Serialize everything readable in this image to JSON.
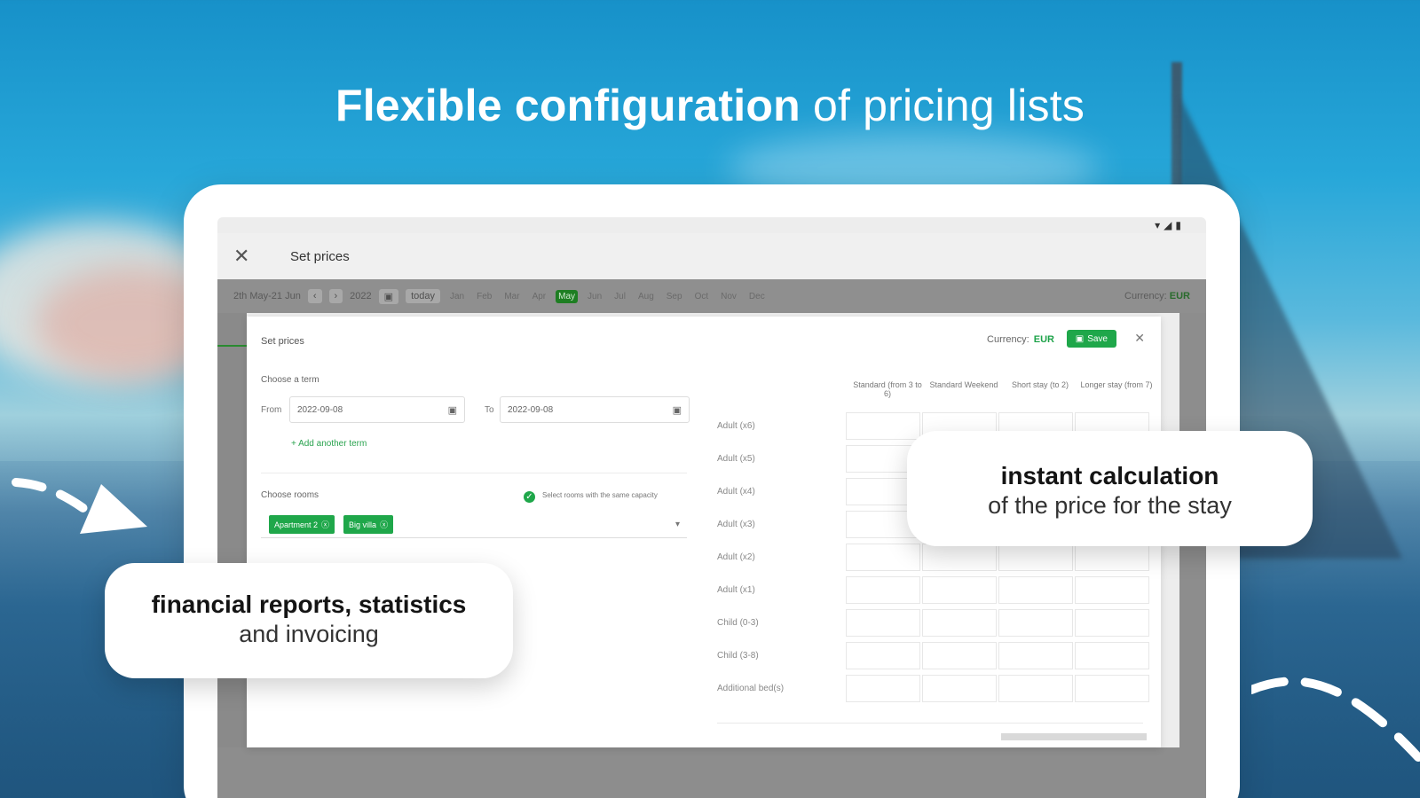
{
  "headline": {
    "strong": "Flexible configuration",
    "light": "of pricing lists"
  },
  "device": {
    "status_icons": [
      "wifi-icon",
      "signal-icon",
      "battery-icon"
    ],
    "appbar": {
      "close_label": "✕",
      "title": "Set prices"
    },
    "background_toolbar": {
      "date_range": "2th May-21 Jun",
      "year": "2022",
      "today": "today",
      "months": [
        "Jan",
        "Feb",
        "Mar",
        "Apr",
        "May",
        "Jun",
        "Jul",
        "Aug",
        "Sep",
        "Oct",
        "Nov",
        "Dec"
      ],
      "active_month": "May",
      "currency_label": "Currency:",
      "currency_value": "EUR"
    },
    "modal": {
      "title": "Set prices",
      "currency_label": "Currency:",
      "currency_value": "EUR",
      "save_label": "Save",
      "close_label": "✕",
      "term_label": "Choose a term",
      "from_label": "From",
      "from_value": "2022-09-08",
      "to_label": "To",
      "to_value": "2022-09-08",
      "add_term": "+ Add another term",
      "rooms_label": "Choose rooms",
      "same_capacity": "Select rooms with the same capacity",
      "selected_rooms": [
        "Apartment 2",
        "Big villa"
      ],
      "price_columns": [
        "Standard (from 3 to 6)",
        "Standard Weekend",
        "Short stay (to 2)",
        "Longer stay (from 7)"
      ],
      "price_rows": [
        "Adult (x6)",
        "Adult (x5)",
        "Adult (x4)",
        "Adult (x3)",
        "Adult (x2)",
        "Adult (x1)",
        "Child (0-3)",
        "Child (3-8)",
        "Additional bed(s)"
      ]
    }
  },
  "callouts": {
    "left": {
      "bold": "financial reports, statistics",
      "normal": "and invoicing"
    },
    "right": {
      "bold": "instant calculation",
      "normal": "of the price for the stay"
    }
  },
  "colors": {
    "accent": "#1fa74a",
    "sky": "#1791c9",
    "dark_text": "#141414"
  }
}
